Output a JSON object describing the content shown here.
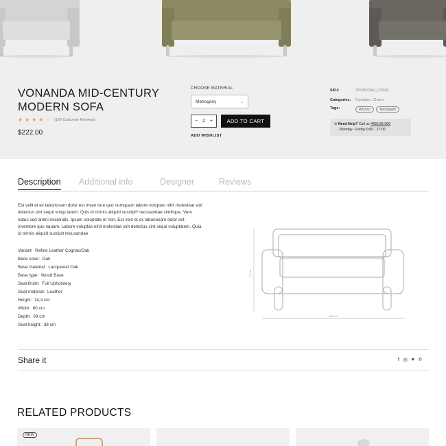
{
  "colors": {
    "hero_bg": "#efefef",
    "sofa_left": "#d4d4d4",
    "sofa_center": "#8c8a62",
    "sofa_right": "#6b6660",
    "button_bg": "#111111",
    "star": "#d7a94a"
  },
  "product": {
    "title": "VONANDA MID-CENTURY MODERN SOFA",
    "rating": 4,
    "reviews": "(126 Customer Reviews)",
    "price": "$222.00"
  },
  "purchase": {
    "material_label": "CHOOSE MATERIAL",
    "material_value": "Mahogany",
    "qty": "2",
    "minus": "−",
    "plus": "+",
    "add_to_cart": "ADD TO CART",
    "wishlist": "ADD WISHLIST"
  },
  "meta": {
    "sku_label": "SKU:",
    "sku": "25528-OAK_COGN",
    "categories_label": "Categories:",
    "categories": "Furniture, Chairs",
    "tags_label": "Tags:",
    "tags": [
      "WOOD",
      "MODERN"
    ],
    "help_title": "Need Help?",
    "help_call": "Call us",
    "help_phone": "4455 85 000",
    "help_hours": "Monday - Friday 9:00 - 17:00"
  },
  "tabs": [
    "Description",
    "Additional info",
    "Designer",
    "Reviews"
  ],
  "description": "Est velit et ex laboriosam dolor est inven tore quo numquam labore voluptas nihil molestiae sint delectus sint sequi volup tatem. Quis id omnis aliquid suscipit* recusandae similique. Vero natus sed animi reiciendis. Ipsum voluptate et non. Est velit et ex laboriosam dolor est inventore quo nquam. Labore voluptas nihil molestiae sint delectus sint sequi voluptatem. Quia id omnis aliquid suscipit recusandae",
  "specs": [
    {
      "k": "Variant:",
      "v": "Refine Leather Cognac/Oak"
    },
    {
      "k": "Base color:",
      "v": "Oak"
    },
    {
      "k": "Base material:",
      "v": "Lacquered Oak"
    },
    {
      "k": "Base type:",
      "v": "Wood Base"
    },
    {
      "k": "Seat finish:",
      "v": "Full Upholstery"
    },
    {
      "k": "Seat material:",
      "v": "Leather"
    },
    {
      "k": "Height:",
      "v": "74,4 cm"
    },
    {
      "k": "Width:",
      "v": "60 cm"
    },
    {
      "k": "Depth:",
      "v": "69 cm"
    },
    {
      "k": "Seat height:",
      "v": "38 cm"
    }
  ],
  "drawing": {
    "height_label": "74 cm",
    "width_label": "160 cm"
  },
  "share": {
    "label": "Share it",
    "icons": [
      "facebook-icon",
      "mail-icon",
      "twitter-icon",
      "pinterest-icon"
    ]
  },
  "related": {
    "title": "RELATED PRODUCTS",
    "badge": "NEW"
  }
}
